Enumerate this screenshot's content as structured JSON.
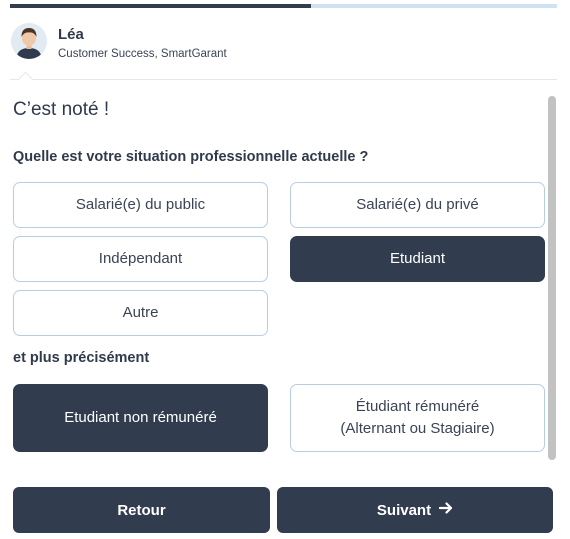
{
  "progress": {
    "fraction": 0.55
  },
  "agent": {
    "name": "Léa",
    "role": "Customer Success, SmartGarant"
  },
  "chat": {
    "acknowledgement": "C’est noté !",
    "question": "Quelle est votre situation professionnelle actuelle ?",
    "options": [
      {
        "label": "Salarié(e) du public",
        "selected": false
      },
      {
        "label": "Salarié(e) du privé",
        "selected": false
      },
      {
        "label": "Indépendant",
        "selected": false
      },
      {
        "label": "Etudiant",
        "selected": true
      },
      {
        "label": "Autre",
        "selected": false
      }
    ],
    "sub_question": "et plus précisément",
    "sub_options": [
      {
        "label": "Etudiant non rémunéré",
        "selected": true
      },
      {
        "label_line1": "Étudiant rémunéré",
        "label_line2": "(Alternant ou Stagiaire)",
        "selected": false
      }
    ]
  },
  "footer": {
    "back_label": "Retour",
    "next_label": "Suivant",
    "next_icon": "arrow-right-icon"
  },
  "colors": {
    "dark": "#323c4f",
    "border": "#b9cde2",
    "progress_track": "#cfe1f2"
  }
}
